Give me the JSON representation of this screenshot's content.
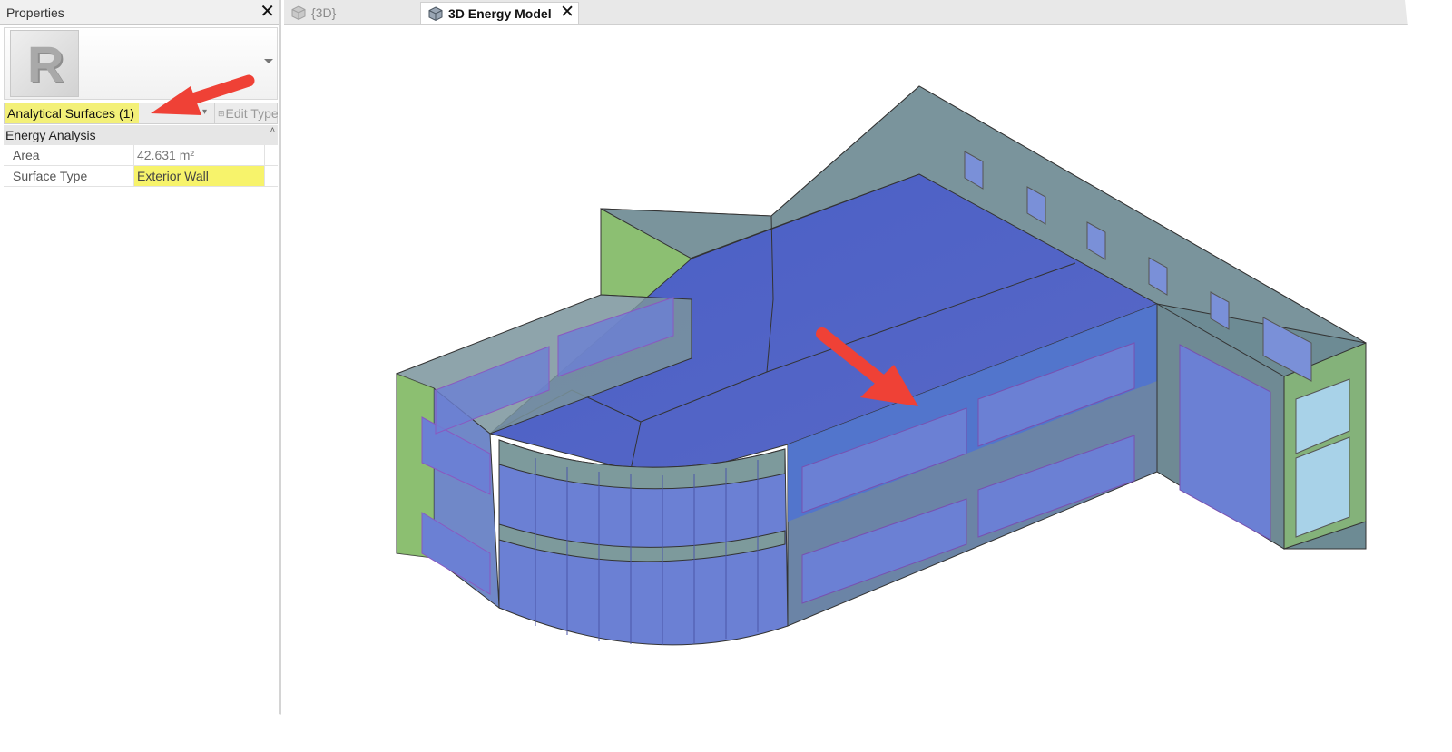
{
  "properties_panel": {
    "title": "Properties",
    "close_glyph": "✕",
    "type_image": {
      "logo_letter": "R"
    },
    "filter": {
      "label": "Analytical Surfaces (1)"
    },
    "edit_type_label": "Edit Type",
    "category": "Energy Analysis",
    "rows": [
      {
        "name": "Area",
        "value": "42.631 m²"
      },
      {
        "name": "Surface Type",
        "value": "Exterior Wall"
      }
    ]
  },
  "tabs": [
    {
      "label": "{3D}",
      "active": false,
      "icon": "3d-view-icon"
    },
    {
      "label": "3D Energy Model",
      "active": true,
      "icon": "3d-view-icon",
      "close_glyph": "✕"
    }
  ],
  "colors": {
    "highlight_yellow": "#f7f36b",
    "annotation_arrow": "#ef4136",
    "wall_surface": "#66858f",
    "roof_surface": "#4b5fc4",
    "window_surface": "#6b80d4",
    "side_wall_green": "#8cbf72"
  }
}
